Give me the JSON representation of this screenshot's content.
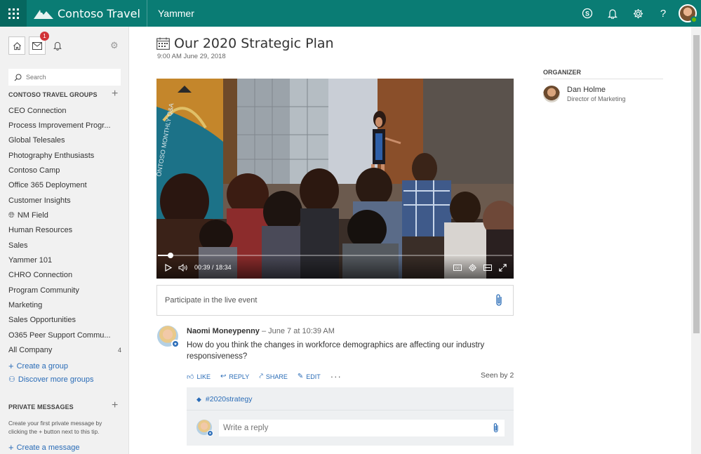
{
  "topbar": {
    "brand": "Contoso Travel",
    "app": "Yammer",
    "colors": {
      "bar": "#0a7c74",
      "waffle": "#06675f"
    },
    "icons": [
      "skype-icon",
      "bell-icon",
      "gear-icon",
      "help-icon",
      "avatar"
    ]
  },
  "sidebar": {
    "mail_badge": "1",
    "search_placeholder": "Search",
    "groups_heading": "CONTOSO TRAVEL GROUPS",
    "groups": [
      {
        "label": "CEO Connection"
      },
      {
        "label": "Process Improvement Progr..."
      },
      {
        "label": "Global Telesales"
      },
      {
        "label": "Photography Enthusiasts"
      },
      {
        "label": "Contoso Camp"
      },
      {
        "label": "Office 365 Deployment"
      },
      {
        "label": "Customer Insights"
      },
      {
        "label": "NM Field",
        "icon": "globe-icon"
      },
      {
        "label": "Human Resources"
      },
      {
        "label": "Sales"
      },
      {
        "label": "Yammer 101"
      },
      {
        "label": "CHRO Connection"
      },
      {
        "label": "Program Community"
      },
      {
        "label": "Marketing"
      },
      {
        "label": "Sales Opportunities"
      },
      {
        "label": "O365 Peer Support Commu..."
      },
      {
        "label": "All Company",
        "count": "4"
      }
    ],
    "create_group": "Create a group",
    "discover_groups": "Discover more groups",
    "pm_heading": "PRIVATE MESSAGES",
    "pm_text": "Create your first private message by clicking the + button next to this tip.",
    "create_message": "Create a message"
  },
  "event": {
    "title": "Our 2020 Strategic Plan",
    "datetime": "9:00 AM June 29, 2018",
    "video": {
      "current_time": "00:39",
      "separator": "/",
      "duration": "18:34",
      "progress": 0.035
    },
    "live_prompt": "Participate in the live event"
  },
  "post": {
    "author": "Naomi Moneypenny",
    "time": "– June 7 at 10:39 AM",
    "body": "How do you think the changes in workforce demographics are affecting our industry responsiveness?",
    "actions": {
      "like": "LIKE",
      "reply": "REPLY",
      "share": "SHARE",
      "edit": "EDIT"
    },
    "seen_by": "Seen by 2",
    "tag": "#2020strategy",
    "reply_placeholder": "Write a reply"
  },
  "organizer": {
    "heading": "ORGANIZER",
    "name": "Dan Holme",
    "role": "Director of Marketing"
  }
}
